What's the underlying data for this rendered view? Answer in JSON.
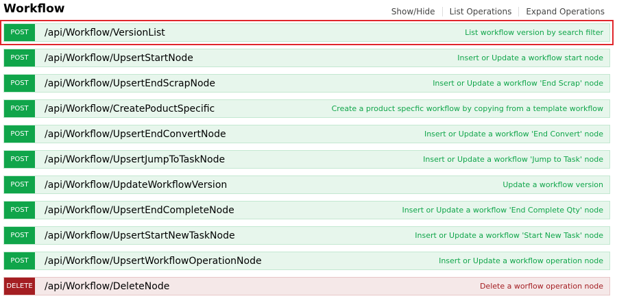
{
  "header": {
    "title": "Workflow",
    "links": [
      "Show/Hide",
      "List Operations",
      "Expand Operations"
    ]
  },
  "colors": {
    "post": "#10a54a",
    "delete": "#a41e22",
    "post_bg": "#e7f6ec",
    "delete_bg": "#f5e8e8",
    "selected_outline": "#e0262b"
  },
  "operations": [
    {
      "method": "POST",
      "path": "/api/Workflow/VersionList",
      "description": "List workflow version by search filter",
      "selected": true
    },
    {
      "method": "POST",
      "path": "/api/Workflow/UpsertStartNode",
      "description": "Insert or Update a workflow start node",
      "selected": false
    },
    {
      "method": "POST",
      "path": "/api/Workflow/UpsertEndScrapNode",
      "description": "Insert or Update a workflow 'End Scrap' node",
      "selected": false
    },
    {
      "method": "POST",
      "path": "/api/Workflow/CreatePoductSpecific",
      "description": "Create a product specfic workflow by copying from a template workflow",
      "selected": false
    },
    {
      "method": "POST",
      "path": "/api/Workflow/UpsertEndConvertNode",
      "description": "Insert or Update a workflow 'End Convert' node",
      "selected": false
    },
    {
      "method": "POST",
      "path": "/api/Workflow/UpsertJumpToTaskNode",
      "description": "Insert or Update a workflow 'Jump to Task' node",
      "selected": false
    },
    {
      "method": "POST",
      "path": "/api/Workflow/UpdateWorkflowVersion",
      "description": "Update a workflow version",
      "selected": false
    },
    {
      "method": "POST",
      "path": "/api/Workflow/UpsertEndCompleteNode",
      "description": "Insert or Update a workflow 'End Complete Qty' node",
      "selected": false
    },
    {
      "method": "POST",
      "path": "/api/Workflow/UpsertStartNewTaskNode",
      "description": "Insert or Update a workflow 'Start New Task' node",
      "selected": false
    },
    {
      "method": "POST",
      "path": "/api/Workflow/UpsertWorkflowOperationNode",
      "description": "Insert or Update a workflow operation node",
      "selected": false
    },
    {
      "method": "DELETE",
      "path": "/api/Workflow/DeleteNode",
      "description": "Delete a worflow operation node",
      "selected": false
    }
  ]
}
